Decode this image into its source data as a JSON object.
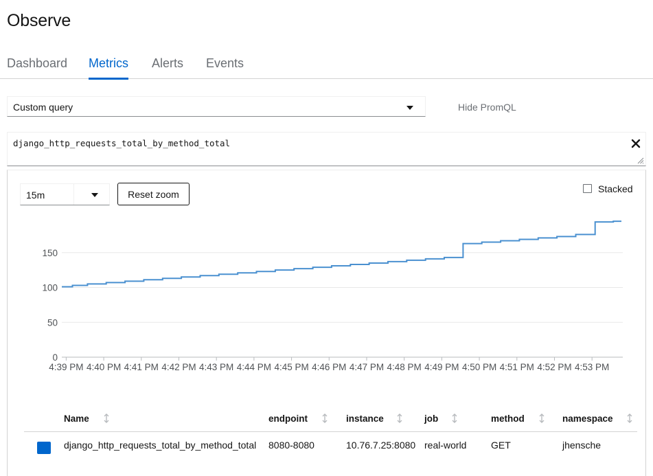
{
  "page": {
    "title": "Observe"
  },
  "tabs": [
    {
      "label": "Dashboard"
    },
    {
      "label": "Metrics",
      "active": true
    },
    {
      "label": "Alerts"
    },
    {
      "label": "Events"
    }
  ],
  "query_selector": {
    "value": "Custom query"
  },
  "promql_toggle": {
    "label": "Hide PromQL"
  },
  "query_input": {
    "value": "django_http_requests_total_by_method_total"
  },
  "time_span": {
    "value": "15m"
  },
  "reset_zoom": {
    "label": "Reset zoom"
  },
  "stacked": {
    "label": "Stacked",
    "checked": false
  },
  "colors": {
    "accent": "#0066cc",
    "series": "#4a90d0",
    "swatch": "#0066cc",
    "grid": "#e8e8e8"
  },
  "chart_data": {
    "type": "line",
    "title": "",
    "xlabel": "",
    "ylabel": "",
    "ylim": [
      0,
      200
    ],
    "y_ticks": [
      0,
      50,
      100,
      150
    ],
    "x_ticks": [
      "4:39 PM",
      "4:40 PM",
      "4:41 PM",
      "4:42 PM",
      "4:43 PM",
      "4:44 PM",
      "4:45 PM",
      "4:46 PM",
      "4:47 PM",
      "4:48 PM",
      "4:49 PM",
      "4:50 PM",
      "4:51 PM",
      "4:52 PM",
      "4:53 PM"
    ],
    "grid": true,
    "series": [
      {
        "x": [
          "4:38:53 PM",
          "4:39:10 PM",
          "4:39:34 PM",
          "4:40:04 PM",
          "4:40:34 PM",
          "4:41:04 PM",
          "4:41:34 PM",
          "4:42:04 PM",
          "4:42:34 PM",
          "4:43:04 PM",
          "4:43:34 PM",
          "4:44:04 PM",
          "4:44:34 PM",
          "4:45:04 PM",
          "4:45:34 PM",
          "4:46:04 PM",
          "4:46:34 PM",
          "4:47:04 PM",
          "4:47:34 PM",
          "4:48:04 PM",
          "4:48:34 PM",
          "4:49:04 PM",
          "4:49:22 PM",
          "4:49:34 PM",
          "4:50:04 PM",
          "4:50:34 PM",
          "4:51:04 PM",
          "4:51:34 PM",
          "4:52:04 PM",
          "4:52:34 PM",
          "4:53:05 PM",
          "4:53:34 PM",
          "4:53:47 PM"
        ],
        "y": [
          101,
          103,
          105,
          107,
          109,
          111,
          113,
          115,
          117,
          119,
          121,
          123,
          125,
          127,
          129,
          131,
          133,
          135,
          137,
          139,
          141,
          143,
          143,
          163,
          165,
          167,
          169,
          171,
          173,
          176,
          194,
          195,
          195
        ]
      }
    ]
  },
  "table": {
    "columns": [
      "Name",
      "endpoint",
      "instance",
      "job",
      "method",
      "namespace"
    ],
    "rows": [
      {
        "name": "django_http_requests_total_by_method_total",
        "endpoint": "8080-8080",
        "instance": "10.76.7.25:8080",
        "job": "real-world",
        "method": "GET",
        "namespace": "jhensche"
      }
    ]
  }
}
